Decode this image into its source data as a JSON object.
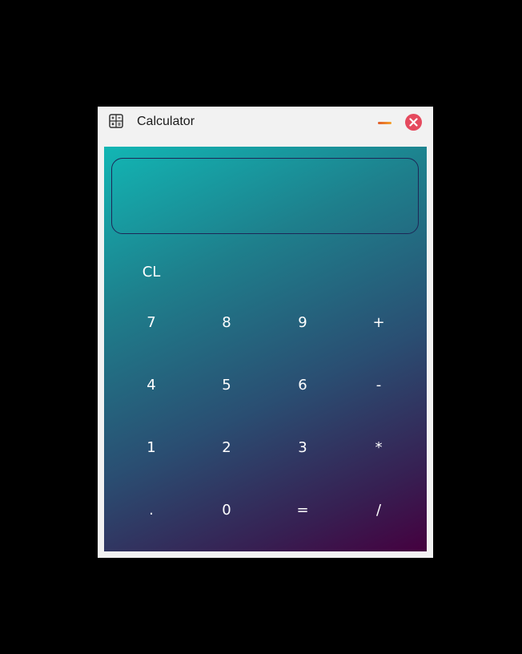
{
  "window": {
    "title": "Calculator",
    "icon": "calculator-icon"
  },
  "titlebar_buttons": {
    "minimize_icon": "minimize-icon",
    "close_icon": "close-icon"
  },
  "display": {
    "value": ""
  },
  "keys": {
    "clear": "CL",
    "seven": "7",
    "eight": "8",
    "nine": "9",
    "plus": "+",
    "four": "4",
    "five": "5",
    "six": "6",
    "minus": "-",
    "one": "1",
    "two": "2",
    "three": "3",
    "multiply": "*",
    "dot": ".",
    "zero": "0",
    "equals": "=",
    "divide": "/"
  },
  "colors": {
    "gradient_start": "#12b6b4",
    "gradient_end": "#45003f",
    "close_button": "#e54a5e",
    "minimize_bar": "#f08a2b",
    "display_border": "#1d2757"
  }
}
